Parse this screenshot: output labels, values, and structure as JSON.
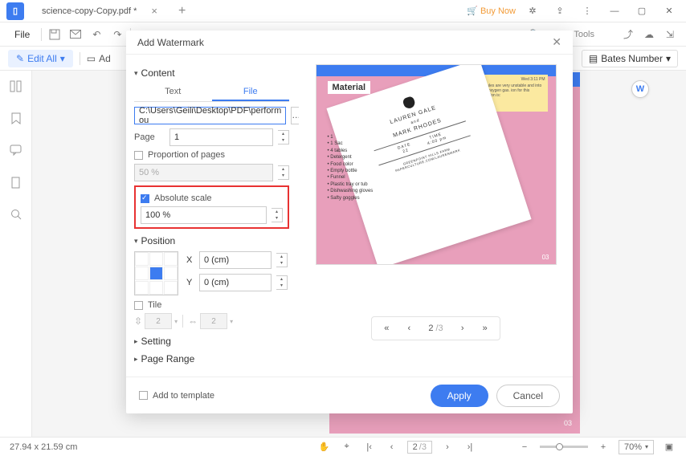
{
  "titlebar": {
    "tab_name": "science-copy-Copy.pdf *",
    "buy_now": "Buy Now"
  },
  "toolbar": {
    "file": "File",
    "search_tools": "Search Tools"
  },
  "editall_row": {
    "edit_all": "Edit All",
    "add": "Ad",
    "bates": "Bates Number"
  },
  "dialog": {
    "title": "Add Watermark",
    "sections": {
      "content": "Content",
      "position": "Position",
      "setting": "Setting",
      "page_range": "Page Range"
    },
    "content": {
      "tab_text": "Text",
      "tab_file": "File",
      "file_path": "C:\\Users\\Geili\\Desktop\\PDF\\perform ou",
      "page_label": "Page",
      "page_value": "1",
      "proportion_label": "Proportion of pages",
      "proportion_value": "50 %",
      "absolute_label": "Absolute scale",
      "absolute_value": "100 %"
    },
    "position": {
      "x_label": "X",
      "y_label": "Y",
      "x_value": "0 (cm)",
      "y_value": "0 (cm)",
      "tile_label": "Tile",
      "tile_a": "2",
      "tile_b": "2"
    },
    "preview": {
      "materials": "Material",
      "name1": "LAUREN GALE",
      "and": "and",
      "name2": "MARK RHODES",
      "date_lbl": "DATE",
      "date_val": "22",
      "time_lbl": "TIME",
      "time_val": "4:00 pm",
      "note_time": "Wed 3:11 PM",
      "bullets": [
        "• 1",
        "• 1 Sac",
        "• 4 tables",
        "• Detergent",
        "• Food color",
        "• Empty bottle",
        "• Funnel",
        "• Plastic tray or tub",
        "• Dishwashing gloves",
        "• Safty goggles"
      ],
      "page_num": "03"
    },
    "pager": {
      "current": "2",
      "total": "/3"
    },
    "footer": {
      "add_template": "Add to template",
      "apply": "Apply",
      "cancel": "Cancel"
    }
  },
  "statusbar": {
    "dims": "27.94 x 21.59 cm",
    "page_current": "2",
    "page_total": "/3",
    "zoom": "70%"
  },
  "bg_page_num": "03"
}
